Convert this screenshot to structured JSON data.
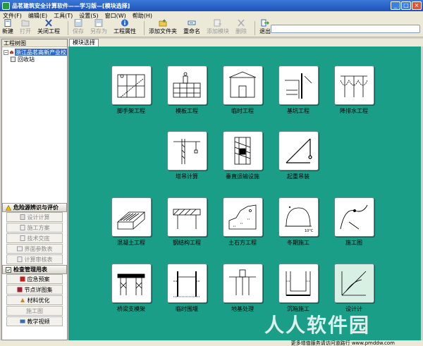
{
  "window": {
    "title": "品茗建筑安全计算软件——学习版—[模块选择]",
    "controls": {
      "minimize": "_",
      "maximize": "□",
      "close": "×"
    }
  },
  "menu": [
    "文件(F)",
    "编辑(E)",
    "工具(T)",
    "设置(S)",
    "窗口(W)",
    "帮助(H)"
  ],
  "toolbar": {
    "buttons": [
      {
        "label": "新建",
        "enabled": true,
        "icon": "new-file-icon"
      },
      {
        "label": "打开",
        "enabled": false,
        "icon": "open-folder-icon"
      },
      {
        "label": "关闭工程",
        "enabled": true,
        "icon": "close-x-icon"
      },
      {
        "label": "保存",
        "enabled": false,
        "icon": "save-icon"
      },
      {
        "label": "另存为",
        "enabled": false,
        "icon": "save-as-icon"
      },
      {
        "label": "工程属性",
        "enabled": true,
        "icon": "info-icon"
      },
      {
        "label": "添加文件夹",
        "enabled": true,
        "icon": "add-folder-icon"
      },
      {
        "label": "重命名",
        "enabled": true,
        "icon": "rename-icon"
      },
      {
        "label": "添加模块",
        "enabled": false,
        "icon": "add-module-icon"
      },
      {
        "label": "删除",
        "enabled": false,
        "icon": "delete-icon"
      },
      {
        "label": "退出",
        "enabled": true,
        "icon": "exit-icon"
      }
    ],
    "search_value": ""
  },
  "left_panel": {
    "title": "工程树图",
    "tree": [
      {
        "label": "浙江品茗高新产业校",
        "selected": true,
        "expander": "−"
      },
      {
        "label": "回收站",
        "selected": false,
        "expander": ""
      }
    ],
    "groups": [
      {
        "label": "危险源辨识与评价",
        "items": [
          "设计计算",
          "施工方案",
          "技术交底",
          "界面参数表",
          "计算审核表"
        ]
      },
      {
        "label": "检查管理用表",
        "items": [
          "应急预案",
          "节点详图集",
          "材料优化",
          "施工图",
          "教学视频"
        ]
      }
    ],
    "active_items": [
      "应急预案",
      "节点详图集",
      "材料优化",
      "教学视频"
    ]
  },
  "tab": {
    "label": "模块选择"
  },
  "modules": [
    {
      "label": "脚手架工程",
      "icon": "scaffold-icon"
    },
    {
      "label": "模板工程",
      "icon": "formwork-icon"
    },
    {
      "label": "临时工程",
      "icon": "temporary-works-icon"
    },
    {
      "label": "基坑工程",
      "icon": "foundation-pit-icon"
    },
    {
      "label": "降排水工程",
      "icon": "dewatering-icon"
    },
    {
      "label": "塔吊计算",
      "icon": "tower-crane-icon"
    },
    {
      "label": "垂直运输设施",
      "icon": "vertical-transport-icon"
    },
    {
      "label": "起重吊装",
      "icon": "hoisting-icon"
    },
    {
      "label": "混凝土工程",
      "icon": "concrete-icon"
    },
    {
      "label": "钢结构工程",
      "icon": "steel-structure-icon"
    },
    {
      "label": "土石方工程",
      "icon": "earthwork-icon"
    },
    {
      "label": "冬期施工",
      "icon": "winter-construction-icon"
    },
    {
      "label": "施工图",
      "icon": "construction-drawing-icon"
    },
    {
      "label": "桥梁支模架",
      "icon": "bridge-formwork-icon"
    },
    {
      "label": "临时围堰",
      "icon": "cofferdam-icon"
    },
    {
      "label": "地基处理",
      "icon": "ground-treatment-icon"
    },
    {
      "label": "沉箱施工",
      "icon": "caisson-icon"
    },
    {
      "label": "设计计",
      "icon": "design-calc-icon"
    }
  ],
  "status": {
    "text": "更多增值服务请访问道路行  www.pmddw.com"
  },
  "watermark": "人人软件园",
  "colors": {
    "workspace": "#1a9e88",
    "titlebar": "#1e52b8",
    "selection": "#316ac5"
  }
}
